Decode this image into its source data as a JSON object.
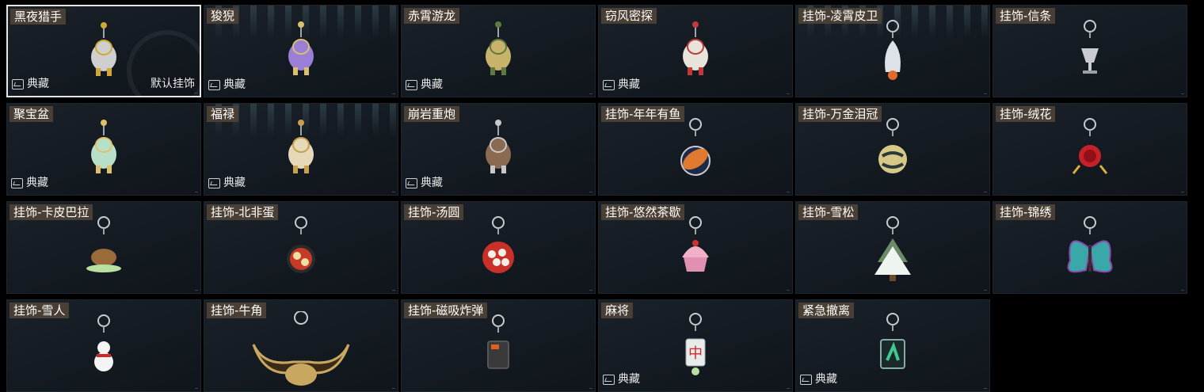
{
  "badge_label": "典藏",
  "default_label": "默认挂饰",
  "items": [
    {
      "title": "黑夜猎手",
      "badge": true,
      "default": true,
      "selected": true,
      "icon": "hunter-figure-icon",
      "color": "#cfcfcf",
      "accent": "#d0a832"
    },
    {
      "title": "狻猊",
      "badge": true,
      "icon": "lion-figure-icon",
      "color": "#9b7fd6",
      "accent": "#d8c070"
    },
    {
      "title": "赤霄游龙",
      "badge": true,
      "icon": "dragon-figure-icon",
      "color": "#c9b36a",
      "accent": "#5e7b3d"
    },
    {
      "title": "窃风密探",
      "badge": true,
      "icon": "rabbit-figure-icon",
      "color": "#e8e4dc",
      "accent": "#c03a3a"
    },
    {
      "title": "挂饰-凌霄皮卫",
      "badge": false,
      "icon": "rocket-icon",
      "color": "#dde2e8",
      "accent": "#e06a2a"
    },
    {
      "title": "挂饰-信条",
      "badge": false,
      "icon": "chalice-icon",
      "color": "#c8ccd0",
      "accent": "#9aa0a6"
    },
    {
      "title": "聚宝盆",
      "badge": true,
      "icon": "treasure-bowl-icon",
      "color": "#b8e0c8",
      "accent": "#e0c068"
    },
    {
      "title": "福禄",
      "badge": true,
      "icon": "gourd-icon",
      "color": "#e6d9b8",
      "accent": "#c8a050"
    },
    {
      "title": "崩岩重炮",
      "badge": true,
      "icon": "cannon-figure-icon",
      "color": "#8a6a50",
      "accent": "#c8c8c8"
    },
    {
      "title": "挂饰-年年有鱼",
      "badge": false,
      "icon": "fish-plate-icon",
      "color": "#e07a30",
      "accent": "#1e2a4a"
    },
    {
      "title": "挂饰-万金泪冠",
      "badge": false,
      "icon": "gold-orb-icon",
      "color": "#d8c888",
      "accent": "#2a3a3a"
    },
    {
      "title": "挂饰-绒花",
      "badge": false,
      "icon": "rose-icon",
      "color": "#c8202a",
      "accent": "#d8b040"
    },
    {
      "title": "挂饰-卡皮巴拉",
      "badge": false,
      "icon": "capybara-icon",
      "color": "#9a6a3a",
      "accent": "#b8e0a0"
    },
    {
      "title": "挂饰-北非蛋",
      "badge": false,
      "icon": "shakshuka-pan-icon",
      "color": "#c83a28",
      "accent": "#f0e0a0"
    },
    {
      "title": "挂饰-汤圆",
      "badge": false,
      "icon": "tangyuan-bowl-icon",
      "color": "#c83028",
      "accent": "#f4f0e8"
    },
    {
      "title": "挂饰-悠然茶歇",
      "badge": false,
      "icon": "cupcake-icon",
      "color": "#f0b0c8",
      "accent": "#ffffff"
    },
    {
      "title": "挂饰-雪松",
      "badge": false,
      "icon": "snow-tree-icon",
      "color": "#f0f4f0",
      "accent": "#6a8a6a"
    },
    {
      "title": "挂饰-锦绣",
      "badge": false,
      "icon": "butterfly-icon",
      "color": "#3aa8a8",
      "accent": "#8a4aa8"
    },
    {
      "title": "挂饰-雪人",
      "badge": false,
      "icon": "snowman-icon",
      "color": "#f4f4f4",
      "accent": "#d02828"
    },
    {
      "title": "挂饰-牛角",
      "badge": false,
      "icon": "bull-horns-icon",
      "color": "#c8a860",
      "accent": "#3a2a18"
    },
    {
      "title": "挂饰-磁吸炸弹",
      "badge": false,
      "icon": "magnet-bomb-icon",
      "color": "#3a3a3a",
      "accent": "#e06020"
    },
    {
      "title": "麻将",
      "badge": true,
      "icon": "mahjong-tile-icon",
      "color": "#e8ece8",
      "accent": "#d02828"
    },
    {
      "title": "紧急撤离",
      "badge": true,
      "icon": "exit-sign-icon",
      "color": "#40c890",
      "accent": "#1a2a2a"
    }
  ]
}
